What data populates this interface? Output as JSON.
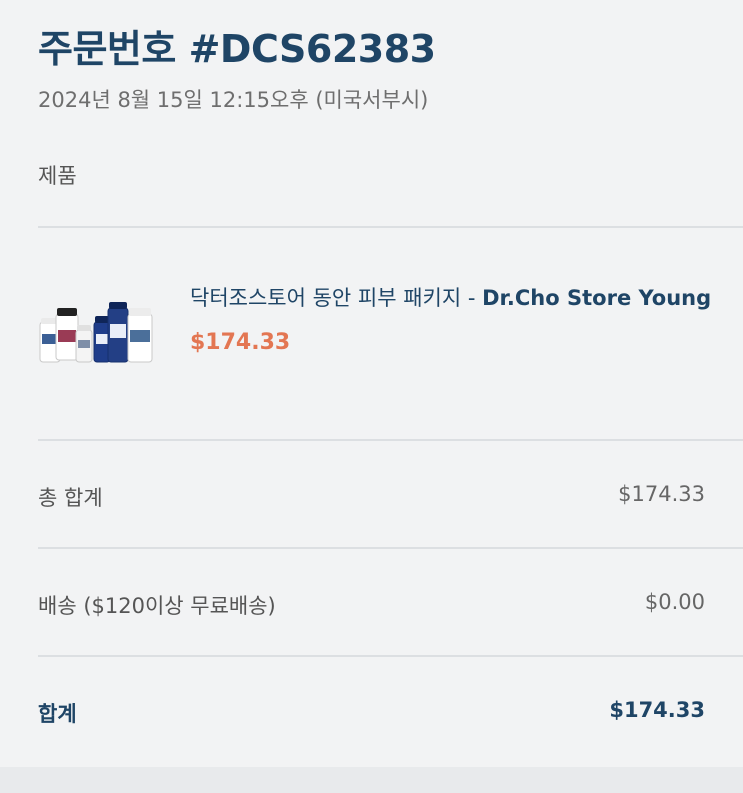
{
  "order": {
    "title": "주문번호 #DCS62383",
    "datetime": "2024년 8월 15일 12:15오후 (미국서부시)"
  },
  "products_section": {
    "label": "제품"
  },
  "product": {
    "name_ko": "닥터조스토어 동안 피부 패키지 - ",
    "name_en": "Dr.Cho Store Young",
    "price": "$174.33",
    "image_name": "supplement-bottles-image"
  },
  "summary": {
    "subtotal_label": "총 합계",
    "subtotal_value": "$174.33",
    "shipping_label": "배송 ($120이상 무료배송)",
    "shipping_value": "$0.00",
    "total_label": "합계",
    "total_value": "$174.33"
  },
  "colors": {
    "title": "#1f4566",
    "price_accent": "#e37652",
    "background": "#f2f3f4"
  }
}
